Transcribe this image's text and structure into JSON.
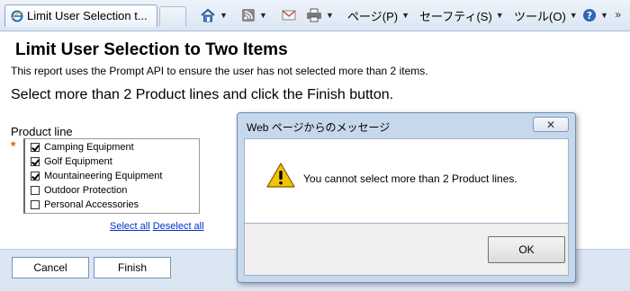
{
  "browser": {
    "tab_title": "Limit User Selection t...",
    "toolbar": {
      "home_icon": "home-icon",
      "feeds_icon": "rss-icon",
      "mail_icon": "mail-icon",
      "print_icon": "printer-icon",
      "page_menu": "ページ(P)",
      "safety_menu": "セーフティ(S)",
      "tools_menu": "ツール(O)",
      "help_icon": "help-icon",
      "more": "»"
    }
  },
  "report": {
    "title": "Limit User Selection to Two Items",
    "description": "This report uses the Prompt API to ensure the user has not selected more than 2 items.",
    "instruction": "Select more than 2 Product lines and click the Finish button.",
    "product_line_label": "Product line",
    "required_marker": "*",
    "options": [
      {
        "label": "Camping Equipment",
        "checked": true
      },
      {
        "label": "Golf Equipment",
        "checked": true
      },
      {
        "label": "Mountaineering Equipment",
        "checked": true
      },
      {
        "label": "Outdoor Protection",
        "checked": false
      },
      {
        "label": "Personal Accessories",
        "checked": false
      }
    ],
    "select_all": "Select all",
    "deselect_all": "Deselect all",
    "cancel_label": "Cancel",
    "finish_label": "Finish"
  },
  "dialog": {
    "title": "Web ページからのメッセージ",
    "close_symbol": "✕",
    "message": "You cannot select more than 2 Product lines.",
    "ok_label": "OK"
  },
  "colors": {
    "toolbar_bg": "#dbe6f3",
    "link": "#0033cc",
    "required": "#e06000",
    "dialog_frame": "#c7d8ed",
    "warning_yellow": "#f4c300"
  }
}
